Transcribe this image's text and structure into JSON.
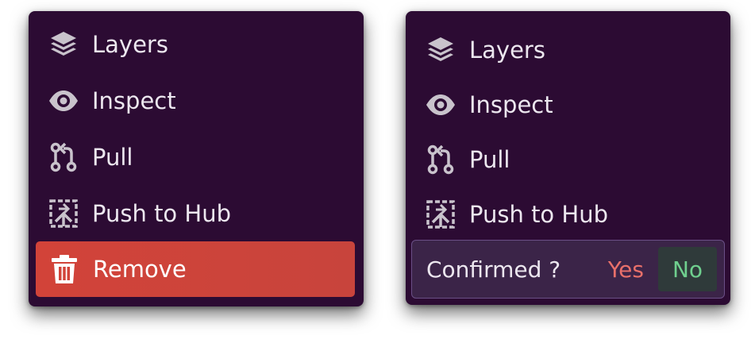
{
  "colors": {
    "menu_bg": "#2c0b33",
    "text": "#ece7ef",
    "icon": "#c9c3cc",
    "danger": "#d24339",
    "yes": "#e8706a",
    "no": "#6fcf8e",
    "confirm_bg": "#3b2448"
  },
  "left_menu": {
    "items": [
      {
        "label": "Layers",
        "icon": "layers-icon"
      },
      {
        "label": "Inspect",
        "icon": "eye-icon"
      },
      {
        "label": "Pull",
        "icon": "git-pull-icon"
      },
      {
        "label": "Push to Hub",
        "icon": "push-to-hub-icon"
      }
    ],
    "remove": {
      "label": "Remove",
      "icon": "trash-icon"
    }
  },
  "right_menu": {
    "items": [
      {
        "label": "Layers",
        "icon": "layers-icon"
      },
      {
        "label": "Inspect",
        "icon": "eye-icon"
      },
      {
        "label": "Pull",
        "icon": "git-pull-icon"
      },
      {
        "label": "Push to Hub",
        "icon": "push-to-hub-icon"
      }
    ],
    "confirm": {
      "question": "Confirmed ?",
      "yes_label": "Yes",
      "no_label": "No"
    }
  }
}
